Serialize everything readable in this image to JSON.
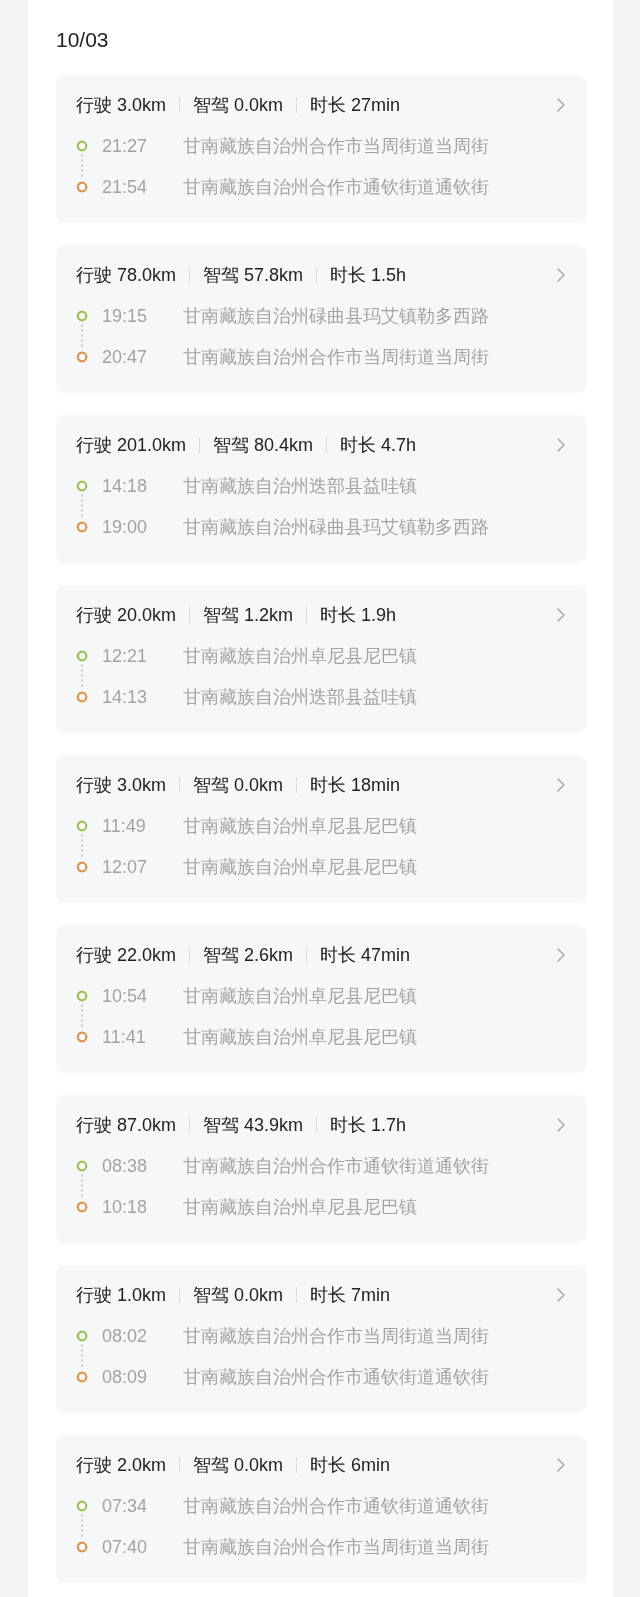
{
  "date": "10/03",
  "trips": [
    {
      "stats": [
        "行驶 3.0km",
        "智驾 0.0km",
        "时长 27min"
      ],
      "start": {
        "time": "21:27",
        "place": "甘南藏族自治州合作市当周街道当周街"
      },
      "end": {
        "time": "21:54",
        "place": "甘南藏族自治州合作市通钦街道通钦街"
      }
    },
    {
      "stats": [
        "行驶 78.0km",
        "智驾 57.8km",
        "时长 1.5h"
      ],
      "start": {
        "time": "19:15",
        "place": "甘南藏族自治州碌曲县玛艾镇勒多西路"
      },
      "end": {
        "time": "20:47",
        "place": "甘南藏族自治州合作市当周街道当周街"
      }
    },
    {
      "stats": [
        "行驶 201.0km",
        "智驾 80.4km",
        "时长 4.7h"
      ],
      "start": {
        "time": "14:18",
        "place": "甘南藏族自治州迭部县益哇镇"
      },
      "end": {
        "time": "19:00",
        "place": "甘南藏族自治州碌曲县玛艾镇勒多西路"
      }
    },
    {
      "stats": [
        "行驶 20.0km",
        "智驾 1.2km",
        "时长 1.9h"
      ],
      "start": {
        "time": "12:21",
        "place": "甘南藏族自治州卓尼县尼巴镇"
      },
      "end": {
        "time": "14:13",
        "place": "甘南藏族自治州迭部县益哇镇"
      }
    },
    {
      "stats": [
        "行驶 3.0km",
        "智驾 0.0km",
        "时长 18min"
      ],
      "start": {
        "time": "11:49",
        "place": "甘南藏族自治州卓尼县尼巴镇"
      },
      "end": {
        "time": "12:07",
        "place": "甘南藏族自治州卓尼县尼巴镇"
      }
    },
    {
      "stats": [
        "行驶 22.0km",
        "智驾 2.6km",
        "时长 47min"
      ],
      "start": {
        "time": "10:54",
        "place": "甘南藏族自治州卓尼县尼巴镇"
      },
      "end": {
        "time": "11:41",
        "place": "甘南藏族自治州卓尼县尼巴镇"
      }
    },
    {
      "stats": [
        "行驶 87.0km",
        "智驾 43.9km",
        "时长 1.7h"
      ],
      "start": {
        "time": "08:38",
        "place": "甘南藏族自治州合作市通钦街道通钦街"
      },
      "end": {
        "time": "10:18",
        "place": "甘南藏族自治州卓尼县尼巴镇"
      }
    },
    {
      "stats": [
        "行驶 1.0km",
        "智驾 0.0km",
        "时长 7min"
      ],
      "start": {
        "time": "08:02",
        "place": "甘南藏族自治州合作市当周街道当周街"
      },
      "end": {
        "time": "08:09",
        "place": "甘南藏族自治州合作市通钦街道通钦街"
      }
    },
    {
      "stats": [
        "行驶 2.0km",
        "智驾 0.0km",
        "时长 6min"
      ],
      "start": {
        "time": "07:34",
        "place": "甘南藏族自治州合作市通钦街道通钦街"
      },
      "end": {
        "time": "07:40",
        "place": "甘南藏族自治州合作市当周街道当周街"
      }
    }
  ]
}
